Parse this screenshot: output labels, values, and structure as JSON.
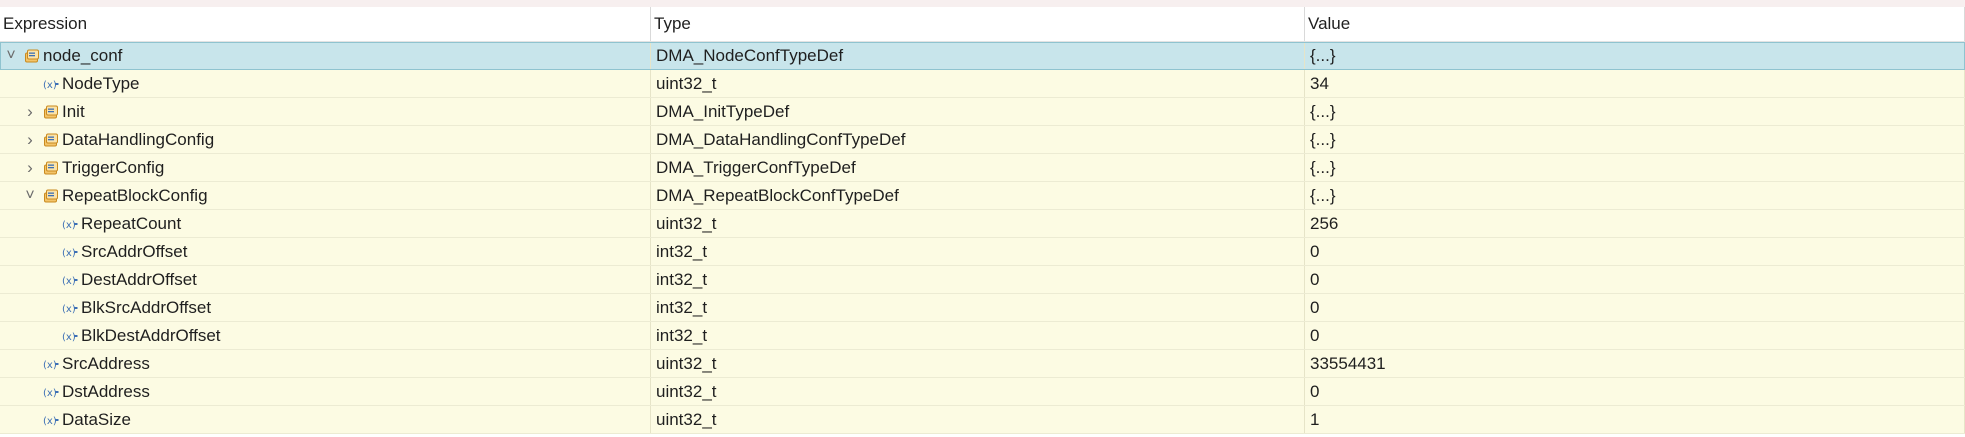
{
  "columns": {
    "expression": "Expression",
    "type": "Type",
    "value": "Value"
  },
  "icons": {
    "struct": "struct-icon",
    "variable": "variable-icon",
    "expand": "chevron-down-icon",
    "collapsed": "chevron-right-icon"
  },
  "colors": {
    "row_background": "#fcfbe3",
    "selected_row": "#c8e5eb",
    "struct_icon": "#e6a23c",
    "variable_icon": "#3c6fb5"
  },
  "rows": [
    {
      "depth": 0,
      "twisty": "expanded",
      "icon": "struct",
      "name": "node_conf",
      "type": "DMA_NodeConfTypeDef",
      "value": "{...}",
      "selected": true
    },
    {
      "depth": 1,
      "twisty": "none",
      "icon": "variable",
      "name": "NodeType",
      "type": "uint32_t",
      "value": "34"
    },
    {
      "depth": 1,
      "twisty": "collapsed",
      "icon": "struct",
      "name": "Init",
      "type": "DMA_InitTypeDef",
      "value": "{...}"
    },
    {
      "depth": 1,
      "twisty": "collapsed",
      "icon": "struct",
      "name": "DataHandlingConfig",
      "type": "DMA_DataHandlingConfTypeDef",
      "value": "{...}"
    },
    {
      "depth": 1,
      "twisty": "collapsed",
      "icon": "struct",
      "name": "TriggerConfig",
      "type": "DMA_TriggerConfTypeDef",
      "value": "{...}"
    },
    {
      "depth": 1,
      "twisty": "expanded",
      "icon": "struct",
      "name": "RepeatBlockConfig",
      "type": "DMA_RepeatBlockConfTypeDef",
      "value": "{...}"
    },
    {
      "depth": 2,
      "twisty": "none",
      "icon": "variable",
      "name": "RepeatCount",
      "type": "uint32_t",
      "value": "256"
    },
    {
      "depth": 2,
      "twisty": "none",
      "icon": "variable",
      "name": "SrcAddrOffset",
      "type": "int32_t",
      "value": "0"
    },
    {
      "depth": 2,
      "twisty": "none",
      "icon": "variable",
      "name": "DestAddrOffset",
      "type": "int32_t",
      "value": "0"
    },
    {
      "depth": 2,
      "twisty": "none",
      "icon": "variable",
      "name": "BlkSrcAddrOffset",
      "type": "int32_t",
      "value": "0"
    },
    {
      "depth": 2,
      "twisty": "none",
      "icon": "variable",
      "name": "BlkDestAddrOffset",
      "type": "int32_t",
      "value": "0"
    },
    {
      "depth": 1,
      "twisty": "none",
      "icon": "variable",
      "name": "SrcAddress",
      "type": "uint32_t",
      "value": "33554431"
    },
    {
      "depth": 1,
      "twisty": "none",
      "icon": "variable",
      "name": "DstAddress",
      "type": "uint32_t",
      "value": "0"
    },
    {
      "depth": 1,
      "twisty": "none",
      "icon": "variable",
      "name": "DataSize",
      "type": "uint32_t",
      "value": "1"
    }
  ]
}
